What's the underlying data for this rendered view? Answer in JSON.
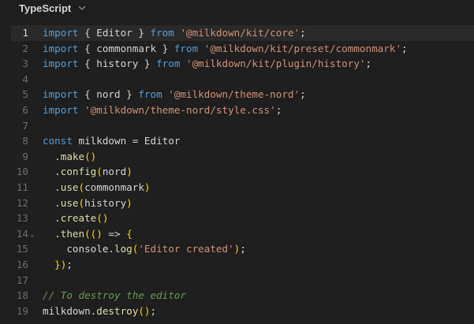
{
  "header": {
    "language": "TypeScript",
    "dropdown_icon": "chevron-down-icon"
  },
  "editor": {
    "active_line": 1,
    "folding_indicator": "chevron-down-icon",
    "lines": [
      {
        "n": "1",
        "t": [
          {
            "k": "kw",
            "v": "import"
          },
          {
            "k": "pl",
            "v": " { Editor } "
          },
          {
            "k": "kw",
            "v": "from"
          },
          {
            "k": "pl",
            "v": " "
          },
          {
            "k": "str",
            "v": "'@milkdown/kit/core'"
          },
          {
            "k": "pl",
            "v": ";"
          }
        ]
      },
      {
        "n": "2",
        "t": [
          {
            "k": "kw",
            "v": "import"
          },
          {
            "k": "pl",
            "v": " { commonmark } "
          },
          {
            "k": "kw",
            "v": "from"
          },
          {
            "k": "pl",
            "v": " "
          },
          {
            "k": "str",
            "v": "'@milkdown/kit/preset/commonmark'"
          },
          {
            "k": "pl",
            "v": ";"
          }
        ]
      },
      {
        "n": "3",
        "t": [
          {
            "k": "kw",
            "v": "import"
          },
          {
            "k": "pl",
            "v": " { history } "
          },
          {
            "k": "kw",
            "v": "from"
          },
          {
            "k": "pl",
            "v": " "
          },
          {
            "k": "str",
            "v": "'@milkdown/kit/plugin/history'"
          },
          {
            "k": "pl",
            "v": ";"
          }
        ]
      },
      {
        "n": "4",
        "t": []
      },
      {
        "n": "5",
        "t": [
          {
            "k": "kw",
            "v": "import"
          },
          {
            "k": "pl",
            "v": " { nord } "
          },
          {
            "k": "kw",
            "v": "from"
          },
          {
            "k": "pl",
            "v": " "
          },
          {
            "k": "str",
            "v": "'@milkdown/theme-nord'"
          },
          {
            "k": "pl",
            "v": ";"
          }
        ]
      },
      {
        "n": "6",
        "t": [
          {
            "k": "kw",
            "v": "import"
          },
          {
            "k": "pl",
            "v": " "
          },
          {
            "k": "str",
            "v": "'@milkdown/theme-nord/style.css'"
          },
          {
            "k": "pl",
            "v": ";"
          }
        ]
      },
      {
        "n": "7",
        "t": []
      },
      {
        "n": "8",
        "t": [
          {
            "k": "kw",
            "v": "const"
          },
          {
            "k": "pl",
            "v": " milkdown = Editor"
          }
        ]
      },
      {
        "n": "9",
        "t": [
          {
            "k": "pl",
            "v": "  ."
          },
          {
            "k": "fn",
            "v": "make"
          },
          {
            "k": "br",
            "v": "()"
          }
        ]
      },
      {
        "n": "10",
        "t": [
          {
            "k": "pl",
            "v": "  ."
          },
          {
            "k": "fn",
            "v": "config"
          },
          {
            "k": "br",
            "v": "("
          },
          {
            "k": "pl",
            "v": "nord"
          },
          {
            "k": "br",
            "v": ")"
          }
        ]
      },
      {
        "n": "11",
        "t": [
          {
            "k": "pl",
            "v": "  ."
          },
          {
            "k": "fn",
            "v": "use"
          },
          {
            "k": "br",
            "v": "("
          },
          {
            "k": "pl",
            "v": "commonmark"
          },
          {
            "k": "br",
            "v": ")"
          }
        ]
      },
      {
        "n": "12",
        "t": [
          {
            "k": "pl",
            "v": "  ."
          },
          {
            "k": "fn",
            "v": "use"
          },
          {
            "k": "br",
            "v": "("
          },
          {
            "k": "pl",
            "v": "history"
          },
          {
            "k": "br",
            "v": ")"
          }
        ]
      },
      {
        "n": "13",
        "t": [
          {
            "k": "pl",
            "v": "  ."
          },
          {
            "k": "fn",
            "v": "create"
          },
          {
            "k": "br",
            "v": "()"
          }
        ]
      },
      {
        "n": "14",
        "fold": true,
        "t": [
          {
            "k": "pl",
            "v": "  ."
          },
          {
            "k": "fn",
            "v": "then"
          },
          {
            "k": "br",
            "v": "(()"
          },
          {
            "k": "pl",
            "v": " => "
          },
          {
            "k": "br",
            "v": "{"
          }
        ]
      },
      {
        "n": "15",
        "t": [
          {
            "k": "pl",
            "v": "    console."
          },
          {
            "k": "fn",
            "v": "log"
          },
          {
            "k": "br",
            "v": "("
          },
          {
            "k": "str",
            "v": "'Editor created'"
          },
          {
            "k": "br",
            "v": ")"
          },
          {
            "k": "pl",
            "v": ";"
          }
        ]
      },
      {
        "n": "16",
        "t": [
          {
            "k": "br",
            "v": "  })"
          },
          {
            "k": "pl",
            "v": ";"
          }
        ]
      },
      {
        "n": "17",
        "t": []
      },
      {
        "n": "18",
        "t": [
          {
            "k": "cm",
            "v": "// To destroy the editor"
          }
        ]
      },
      {
        "n": "19",
        "t": [
          {
            "k": "pl",
            "v": "milkdown."
          },
          {
            "k": "fn",
            "v": "destroy"
          },
          {
            "k": "br",
            "v": "()"
          },
          {
            "k": "pl",
            "v": ";"
          }
        ]
      }
    ]
  },
  "colors": {
    "background": "#1e1e1e",
    "keyword": "#569cd6",
    "string": "#ce9178",
    "function": "#dcdcaa",
    "bracket": "#ffd700",
    "comment": "#6a9955",
    "plain": "#d4d4d4",
    "line_number": "#6d6d6d"
  }
}
